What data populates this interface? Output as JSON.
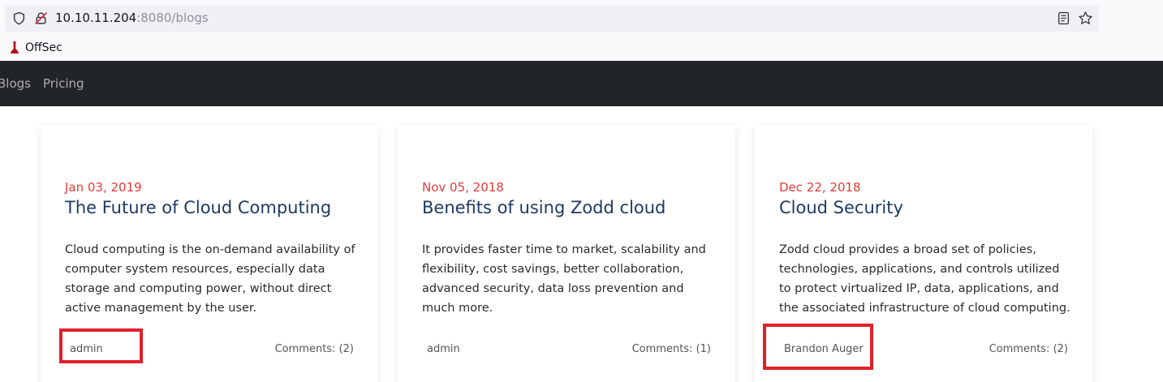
{
  "browser": {
    "url_host": "10.10.11.204",
    "url_rest": ":8080/blogs",
    "bookmark_label": "OffSec"
  },
  "nav": {
    "items": [
      {
        "label": "Blogs"
      },
      {
        "label": "Pricing"
      }
    ]
  },
  "posts": [
    {
      "date": "Jan 03, 2019",
      "title": "The Future of Cloud Computing",
      "excerpt": "Cloud computing is the on-demand availability of computer system resources, especially data storage and computing power, without direct active management by the user.",
      "author": "admin",
      "comments": "Comments: (2)"
    },
    {
      "date": "Nov 05, 2018",
      "title": "Benefits of using Zodd cloud",
      "excerpt": "It provides faster time to market, scalability and flexibility, cost savings, better collaboration, advanced security, data loss prevention and much more.",
      "author": "admin",
      "comments": "Comments: (1)"
    },
    {
      "date": "Dec 22, 2018",
      "title": "Cloud Security",
      "excerpt": "Zodd cloud provides a broad set of policies, technologies, applications, and controls utilized to protect virtualized IP, data, applications, and the associated infrastructure of cloud computing.",
      "author": "Brandon Auger",
      "comments": "Comments: (2)"
    }
  ],
  "colors": {
    "navbar_bg": "#212529",
    "date_red": "#e23a3a",
    "title_navy": "#1f3a63",
    "highlight_red": "#e0202a"
  }
}
